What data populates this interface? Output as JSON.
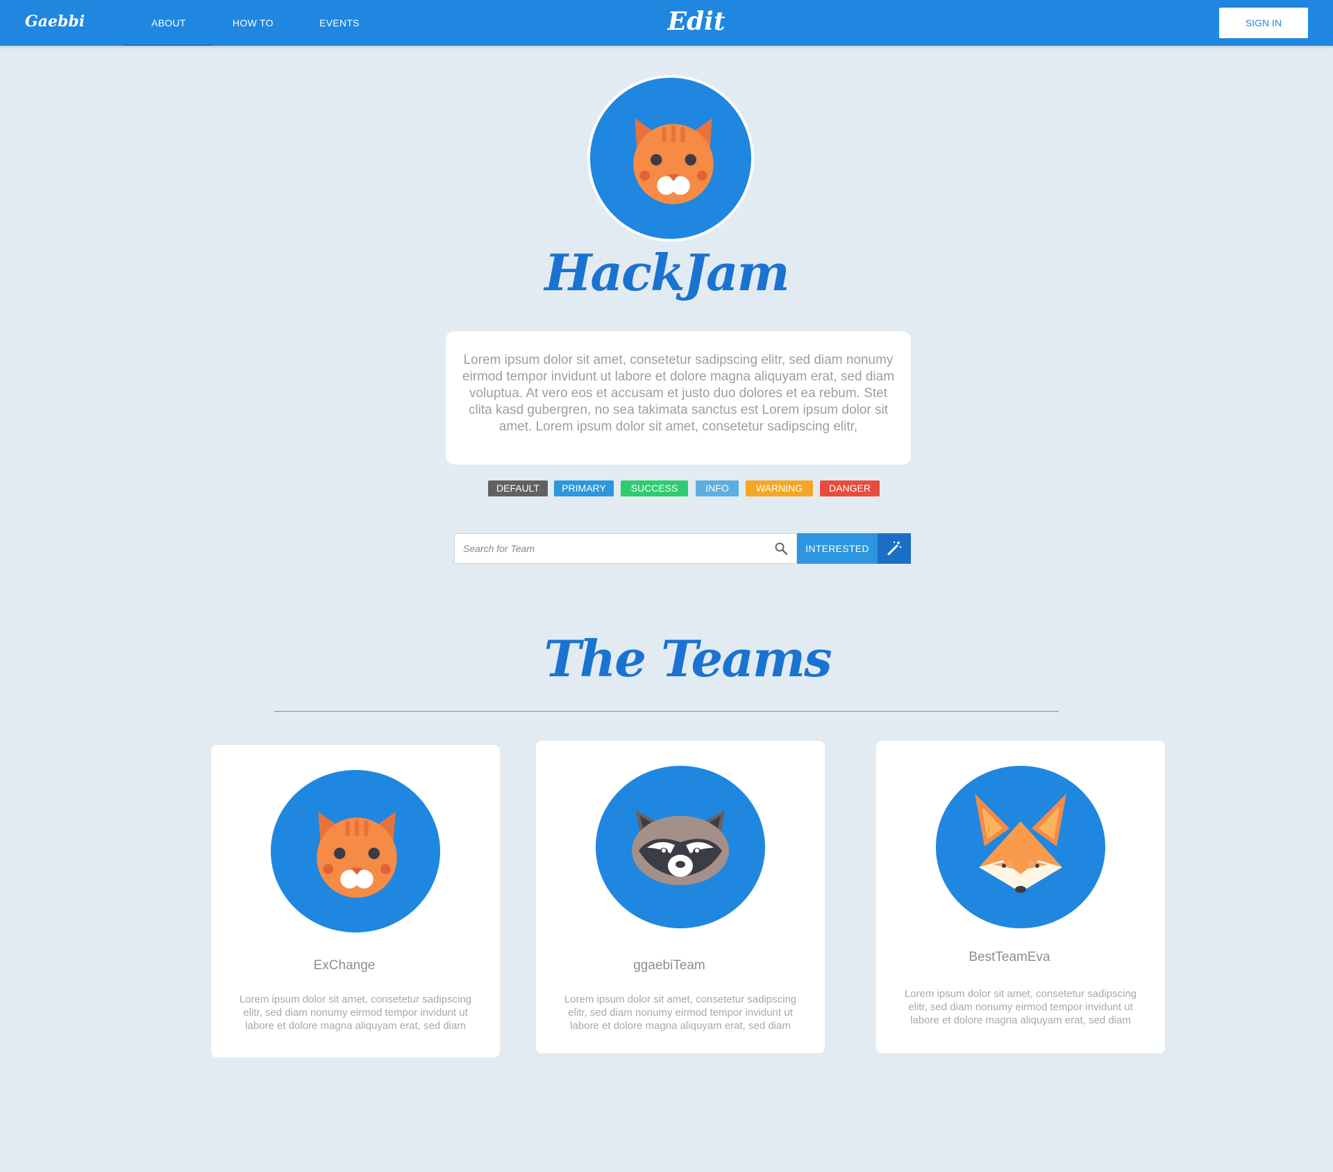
{
  "nav": {
    "brand": "Gaebbi",
    "items": [
      "ABOUT",
      "HOW TO",
      "EVENTS"
    ],
    "active_item": "ABOUT",
    "center_title": "Edit",
    "signin_label": "SIGN IN"
  },
  "colors": {
    "primary": "#1f87e0",
    "background": "#e2ebf2",
    "heading": "#1a73d0"
  },
  "hero": {
    "avatar_icon": "cat-icon",
    "title": "HackJam",
    "description": "Lorem ipsum dolor sit amet, consetetur sadipscing elitr, sed diam nonumy eirmod tempor invidunt ut labore et dolore magna aliquyam erat, sed diam voluptua. At vero eos et accusam et justo duo dolores et ea rebum. Stet clita kasd gubergren, no sea takimata sanctus est Lorem ipsum dolor sit amet. Lorem ipsum dolor sit amet, consetetur sadipscing elitr,"
  },
  "tags": [
    {
      "label": "DEFAULT",
      "color": "#616161"
    },
    {
      "label": "PRIMARY",
      "color": "#2c96de"
    },
    {
      "label": "SUCCESS",
      "color": "#2ecc71"
    },
    {
      "label": "INFO",
      "color": "#5dade2"
    },
    {
      "label": "WARNING",
      "color": "#f5a623"
    },
    {
      "label": "DANGER",
      "color": "#e74c3c"
    }
  ],
  "search": {
    "placeholder": "Search for Team",
    "value": "",
    "interested_label": "INTERESTED",
    "wand_icon": "magic-wand-icon"
  },
  "teams_section": {
    "title": "The Teams",
    "teams": [
      {
        "name": "ExChange",
        "icon": "cat-icon",
        "description": "Lorem ipsum dolor sit amet, consetetur sadipscing elitr, sed diam nonumy eirmod tempor invidunt ut labore et dolore magna aliquyam erat, sed diam"
      },
      {
        "name": "ggaebiTeam",
        "icon": "raccoon-icon",
        "description": "Lorem ipsum dolor sit amet, consetetur sadipscing elitr, sed diam nonumy eirmod tempor invidunt ut labore et dolore magna aliquyam erat, sed diam"
      },
      {
        "name": "BestTeamEva",
        "icon": "fox-icon",
        "description": "Lorem ipsum dolor sit amet, consetetur sadipscing elitr, sed diam nonumy eirmod tempor invidunt ut labore et dolore magna aliquyam erat, sed diam"
      }
    ]
  }
}
